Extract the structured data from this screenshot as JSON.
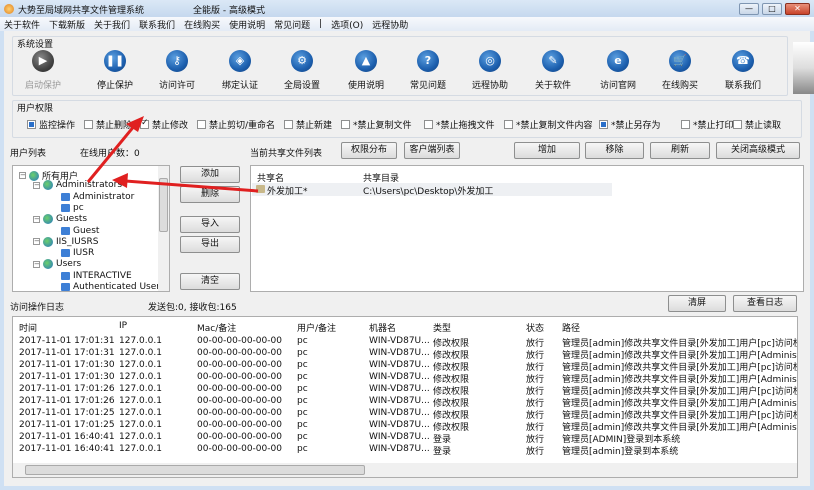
{
  "window": {
    "title": "大势至局域网共享文件管理系统",
    "edition": "全能版 - 高级模式",
    "controls": [
      "—",
      "□",
      "✕"
    ]
  },
  "menu": [
    "关于软件",
    "下载新版",
    "关于我们",
    "联系我们",
    "在线购买",
    "使用说明",
    "常见问题",
    "|",
    "选项(O)",
    "远程协助"
  ],
  "system": {
    "label": "系统设置",
    "tools": [
      {
        "label": "启动保护",
        "icon": "play-icon",
        "glyph": "▶",
        "disabled": true
      },
      {
        "label": "停止保护",
        "icon": "pause-icon",
        "glyph": "❚❚"
      },
      {
        "label": "访问许可",
        "icon": "key-icon",
        "glyph": "⚷"
      },
      {
        "label": "绑定认证",
        "icon": "shield-icon",
        "glyph": "◈"
      },
      {
        "label": "全局设置",
        "icon": "gear-icon",
        "glyph": "⚙"
      },
      {
        "label": "使用说明",
        "icon": "graduation-cap-icon",
        "glyph": "▲"
      },
      {
        "label": "常见问题",
        "icon": "question-icon",
        "glyph": "?"
      },
      {
        "label": "远程协助",
        "icon": "remote-icon",
        "glyph": "◎"
      },
      {
        "label": "关于软件",
        "icon": "about-icon",
        "glyph": "✎"
      },
      {
        "label": "访问官网",
        "icon": "ie-icon",
        "glyph": "e"
      },
      {
        "label": "在线购买",
        "icon": "cart-icon",
        "glyph": "🛒"
      },
      {
        "label": "联系我们",
        "icon": "phone-icon",
        "glyph": "☎"
      }
    ]
  },
  "permissions": {
    "label": "用户权限",
    "items": [
      {
        "label": "监控操作",
        "state": "filled"
      },
      {
        "label": "禁止删除",
        "state": "off"
      },
      {
        "label": "禁止修改",
        "state": "checked"
      },
      {
        "label": "禁止剪切/重命名",
        "state": "off"
      },
      {
        "label": "禁止新建",
        "state": "off"
      },
      {
        "label": "*禁止复制文件",
        "state": "off"
      },
      {
        "label": "*禁止拖拽文件",
        "state": "off"
      },
      {
        "label": "*禁止复制文件内容",
        "state": "off"
      },
      {
        "label": "*禁止另存为",
        "state": "filled"
      },
      {
        "label": "*禁止打印",
        "state": "off"
      },
      {
        "label": "禁止读取",
        "state": "off"
      }
    ]
  },
  "users": {
    "label": "用户列表",
    "online": "在线用户数：0",
    "tree": [
      {
        "label": "所有用户",
        "type": "group",
        "level": 0
      },
      {
        "label": "Administrators",
        "type": "group",
        "level": 1
      },
      {
        "label": "Administrator",
        "type": "user",
        "level": 2
      },
      {
        "label": "pc",
        "type": "user",
        "level": 2
      },
      {
        "label": "Guests",
        "type": "group",
        "level": 1
      },
      {
        "label": "Guest",
        "type": "user",
        "level": 2
      },
      {
        "label": "IIS_IUSRS",
        "type": "group",
        "level": 1
      },
      {
        "label": "IUSR",
        "type": "user",
        "level": 2
      },
      {
        "label": "Users",
        "type": "group",
        "level": 1
      },
      {
        "label": "INTERACTIVE",
        "type": "user",
        "level": 2
      },
      {
        "label": "Authenticated Users",
        "type": "user",
        "level": 2
      }
    ],
    "buttons": {
      "add": "添加",
      "delete": "删除",
      "import": "导入",
      "export": "导出",
      "clear": "清空"
    }
  },
  "shares": {
    "label": "当前共享文件列表",
    "perm_btn": "权限分布",
    "client_btn": "客户端列表",
    "add": "增加",
    "remove": "移除",
    "refresh": "刷新",
    "close_adv": "关闭高级模式",
    "columns": [
      "共享名",
      "共享目录"
    ],
    "rows": [
      [
        "外发加工*",
        "C:\\Users\\pc\\Desktop\\外发加工"
      ]
    ]
  },
  "log": {
    "label": "访问操作日志",
    "stats": "发送包:0, 接收包:165",
    "clear": "清屏",
    "view": "查看日志",
    "columns": [
      "时间",
      "IP",
      "Mac/备注",
      "用户/备注",
      "机器名",
      "类型",
      "状态",
      "路径"
    ],
    "rows": [
      [
        "2017-11-01 17:01:31",
        "127.0.0.1",
        "00-00-00-00-00-00",
        "pc",
        "WIN-VD87U...",
        "修改权限",
        "放行",
        "管理员[admin]修改共享文件目录[外发加工]用户[pc]访问权限"
      ],
      [
        "2017-11-01 17:01:31",
        "127.0.0.1",
        "00-00-00-00-00-00",
        "pc",
        "WIN-VD87U...",
        "修改权限",
        "放行",
        "管理员[admin]修改共享文件目录[外发加工]用户[Administrato"
      ],
      [
        "2017-11-01 17:01:30",
        "127.0.0.1",
        "00-00-00-00-00-00",
        "pc",
        "WIN-VD87U...",
        "修改权限",
        "放行",
        "管理员[admin]修改共享文件目录[外发加工]用户[pc]访问权限"
      ],
      [
        "2017-11-01 17:01:30",
        "127.0.0.1",
        "00-00-00-00-00-00",
        "pc",
        "WIN-VD87U...",
        "修改权限",
        "放行",
        "管理员[admin]修改共享文件目录[外发加工]用户[Administrato"
      ],
      [
        "2017-11-01 17:01:26",
        "127.0.0.1",
        "00-00-00-00-00-00",
        "pc",
        "WIN-VD87U...",
        "修改权限",
        "放行",
        "管理员[admin]修改共享文件目录[外发加工]用户[pc]访问权限"
      ],
      [
        "2017-11-01 17:01:26",
        "127.0.0.1",
        "00-00-00-00-00-00",
        "pc",
        "WIN-VD87U...",
        "修改权限",
        "放行",
        "管理员[admin]修改共享文件目录[外发加工]用户[Administrato"
      ],
      [
        "2017-11-01 17:01:25",
        "127.0.0.1",
        "00-00-00-00-00-00",
        "pc",
        "WIN-VD87U...",
        "修改权限",
        "放行",
        "管理员[admin]修改共享文件目录[外发加工]用户[pc]访问权限"
      ],
      [
        "2017-11-01 17:01:25",
        "127.0.0.1",
        "00-00-00-00-00-00",
        "pc",
        "WIN-VD87U...",
        "修改权限",
        "放行",
        "管理员[admin]修改共享文件目录[外发加工]用户[Administrato"
      ],
      [
        "2017-11-01 16:40:41",
        "127.0.0.1",
        "00-00-00-00-00-00",
        "pc",
        "WIN-VD87U...",
        "登录",
        "放行",
        "管理员[ADMIN]登录到本系统"
      ],
      [
        "2017-11-01 16:40:41",
        "127.0.0.1",
        "00-00-00-00-00-00",
        "pc",
        "WIN-VD87U...",
        "登录",
        "放行",
        "管理员[admin]登录到本系统"
      ]
    ]
  },
  "colors": {
    "accent": "#2a6fc9",
    "arrow": "#e02020"
  }
}
